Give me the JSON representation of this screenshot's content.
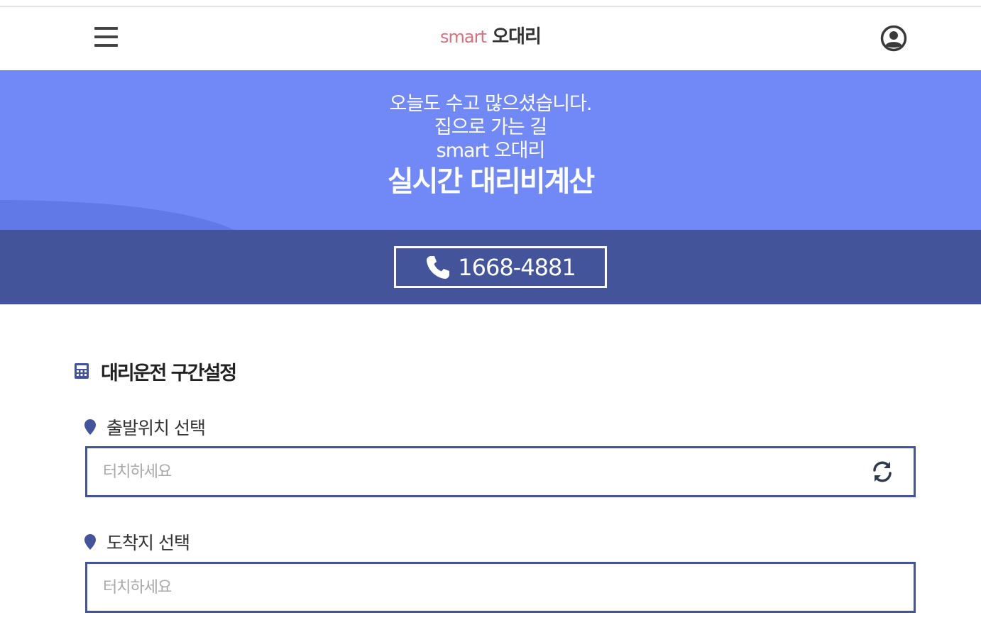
{
  "header": {
    "logo_smart": "smart",
    "logo_name": "오대리",
    "menu_icon": "hamburger-menu-icon",
    "user_icon": "user-account-icon"
  },
  "hero": {
    "line1": "오늘도 수고 많으셨습니다.",
    "line2": "집으로 가는 길",
    "line3": "smart 오대리",
    "headline": "실시간 대리비계산",
    "bg_color": "#7189f7"
  },
  "phone": {
    "number": "1668-4881",
    "icon": "phone-icon",
    "band_color": "#44549b"
  },
  "section": {
    "title": "대리운전 구간설정",
    "icon": "calculator-icon"
  },
  "start": {
    "label": "출발위치 선택",
    "placeholder": "터치하세요",
    "value": "",
    "icon": "map-pin-icon",
    "action_icon": "refresh-icon"
  },
  "end": {
    "label": "도착지 선택",
    "placeholder": "터치하세요",
    "value": "",
    "icon": "map-pin-icon"
  }
}
